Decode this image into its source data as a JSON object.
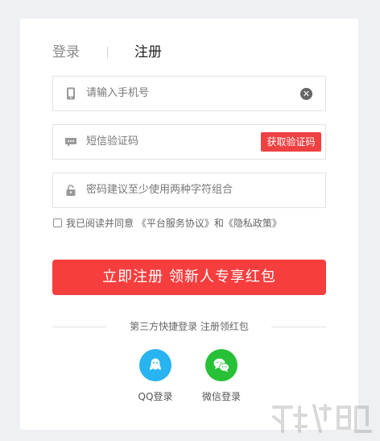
{
  "tabs": {
    "login": "登录",
    "register": "注册"
  },
  "form": {
    "phone_placeholder": "请输入手机号",
    "code_placeholder": "短信验证码",
    "get_code_label": "获取验证码",
    "password_placeholder": "密码建议至少使用两种字符组合"
  },
  "agreement": {
    "text": "我已阅读并同意 《平台服务协议》和《隐私政策》"
  },
  "submit_label": "立即注册 领新人专享红包",
  "third_party": {
    "label": "第三方快捷登录 注册领红包",
    "qq_label": "QQ登录",
    "wechat_label": "微信登录"
  },
  "icons": [
    "phone-icon",
    "message-icon",
    "lock-icon",
    "clear-icon",
    "qq-icon",
    "wechat-icon",
    "watermark-logo"
  ],
  "colors": {
    "accent": "#f04142",
    "qq": "#27b4f0",
    "wechat": "#26c136"
  }
}
